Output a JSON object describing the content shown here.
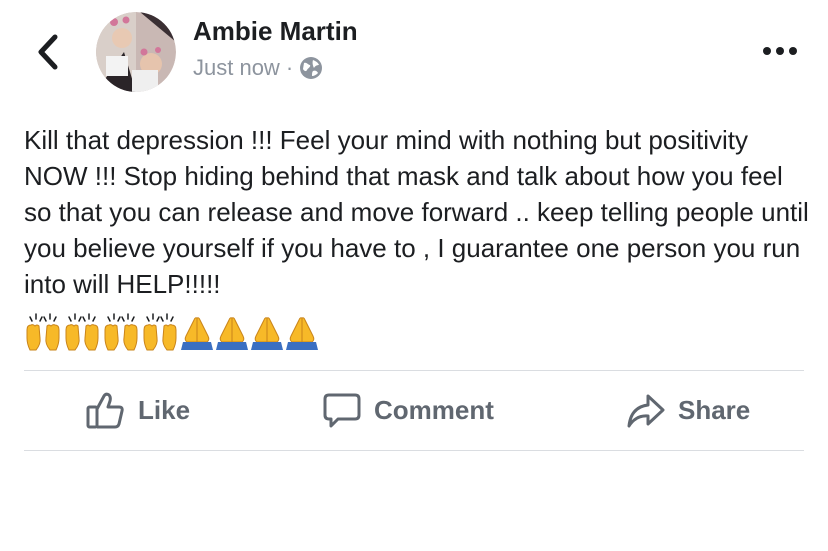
{
  "post": {
    "author_name": "Ambie Martin",
    "timestamp": "Just now",
    "separator": "·",
    "privacy_icon": "globe-icon",
    "text": "Kill that depression !!! Feel your mind with nothing but positivity NOW !!! Stop hiding behind that mask and talk about how you feel so that you can release and move forward .. keep telling people until you believe yourself if you have to , I guarantee one person you run into will HELP!!!!!",
    "emojis": [
      "raising-hands",
      "raising-hands",
      "raising-hands",
      "raising-hands",
      "folded-hands",
      "folded-hands",
      "folded-hands",
      "folded-hands"
    ]
  },
  "header": {
    "back_icon": "chevron-left-icon",
    "more_icon": "more-horizontal-icon"
  },
  "actions": {
    "like_label": "Like",
    "comment_label": "Comment",
    "share_label": "Share"
  },
  "colors": {
    "text": "#1c1e21",
    "secondary": "#8d949e",
    "action": "#606770",
    "divider": "#dadde1",
    "emoji_yellow": "#f7b928",
    "emoji_blue": "#3b6fc2"
  }
}
